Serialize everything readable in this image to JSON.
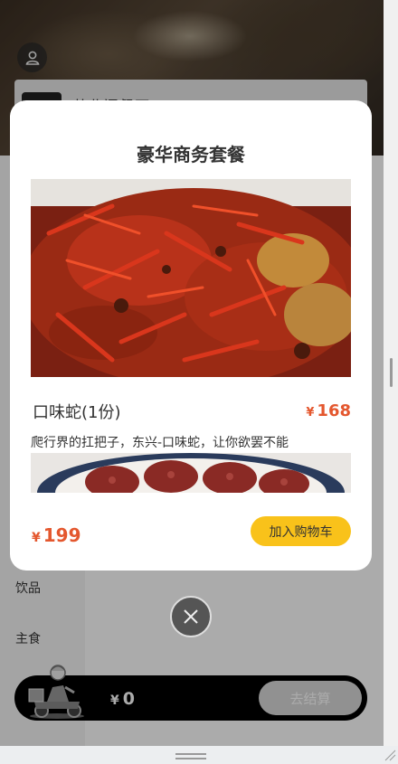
{
  "shop": {
    "name": "营业门餐厅"
  },
  "categories": [
    {
      "label": "饮品"
    },
    {
      "label": "主食"
    }
  ],
  "modal": {
    "title": "豪华商务套餐",
    "item": {
      "name": "口味蛇(1份)",
      "currency": "¥",
      "price": "168",
      "description": "爬行界的扛把子，东兴-口味蛇，让你欲罢不能"
    },
    "total": {
      "currency": "¥",
      "price": "199"
    },
    "add_to_cart_label": "加入购物车"
  },
  "cart": {
    "currency": "¥",
    "total": "0",
    "checkout_label": "去结算"
  },
  "colors": {
    "accent_red": "#e4572e",
    "button_yellow": "#f9c21a",
    "cart_bar": "#000000",
    "checkout_disabled": "#d8d8d8"
  },
  "icons": {
    "avatar": "user-icon",
    "close": "close-icon",
    "courier": "delivery-rider-icon"
  }
}
